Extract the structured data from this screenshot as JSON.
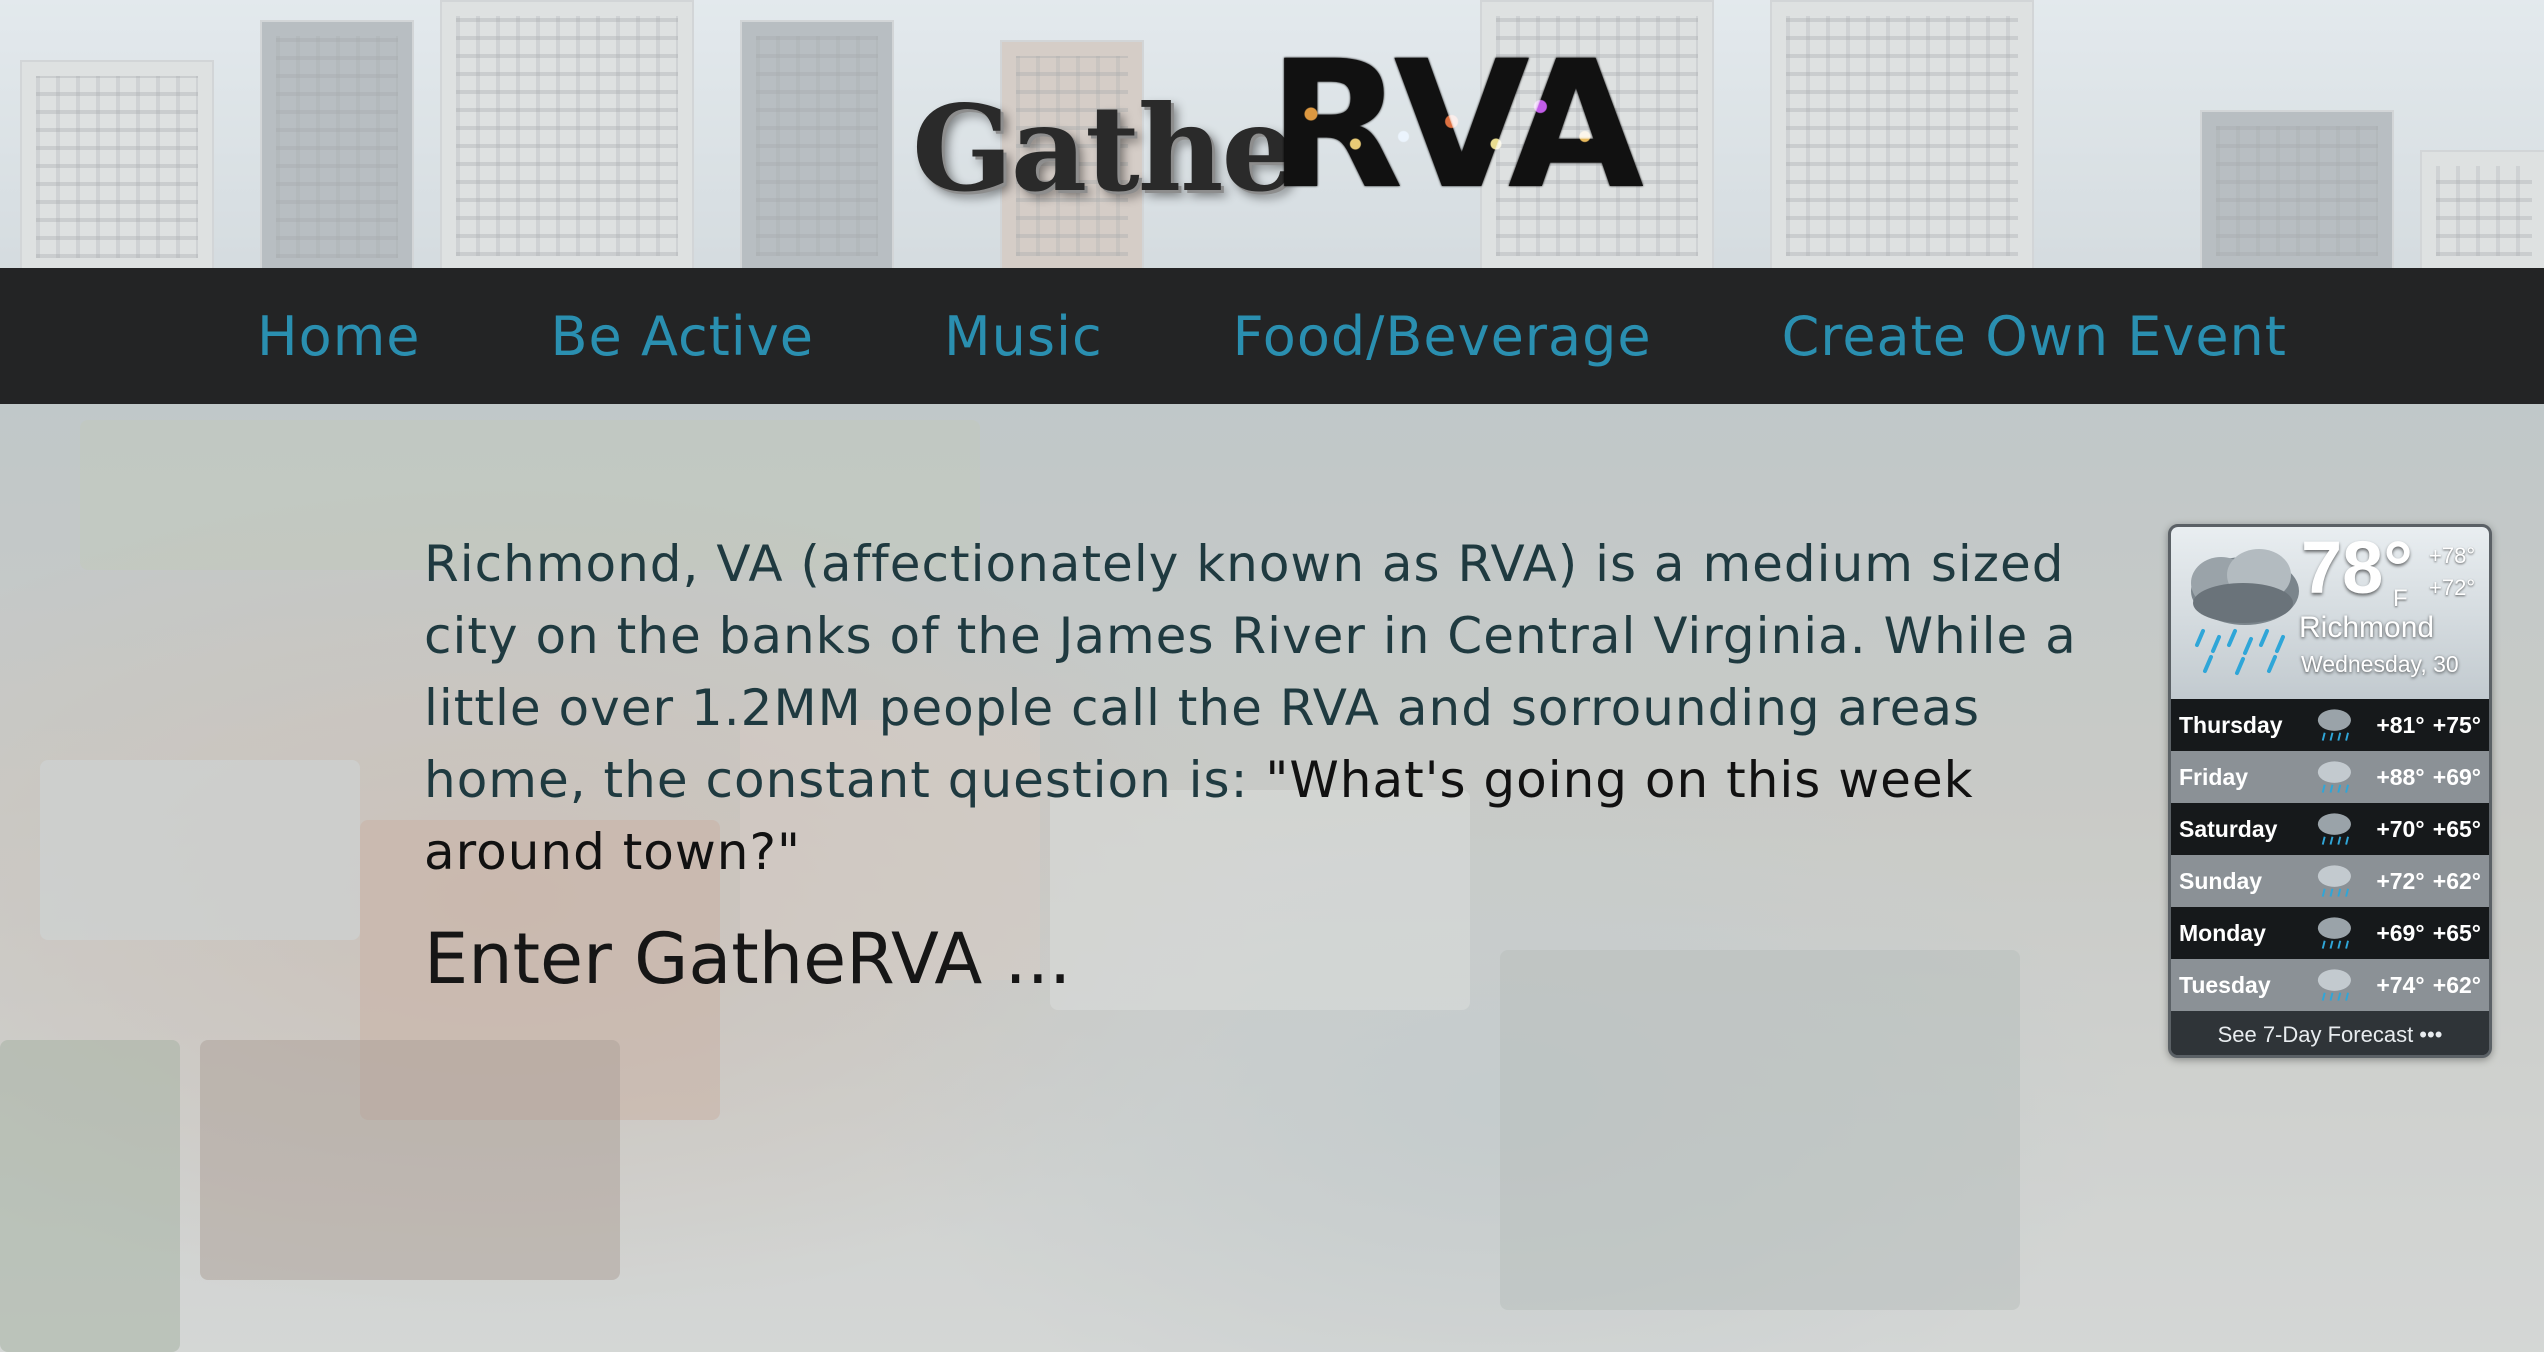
{
  "logo": {
    "script_text": "Gathe",
    "block_text": "RVA"
  },
  "nav": {
    "items": [
      {
        "label": "Home"
      },
      {
        "label": "Be Active"
      },
      {
        "label": "Music"
      },
      {
        "label": "Food/Beverage"
      },
      {
        "label": "Create Own Event"
      }
    ]
  },
  "intro": {
    "paragraph": "Richmond, VA (affectionately known as RVA) is a medium sized city on the banks of the James River in Central Virginia. While a little over 1.2MM people call the RVA and sorrounding areas home, the constant question is: ",
    "quote": "\"What's going on this week around town?\"",
    "enter": "Enter GatheRVA ..."
  },
  "weather": {
    "current_temp": "78°",
    "unit": "F",
    "hi": "+78°",
    "lo": "+72°",
    "city": "Richmond",
    "date": "Wednesday, 30",
    "forecast": [
      {
        "day": "Thursday",
        "hi": "+81°",
        "lo": "+75°",
        "icon": "rain-cloud-icon"
      },
      {
        "day": "Friday",
        "hi": "+88°",
        "lo": "+69°",
        "icon": "rain-cloud-icon"
      },
      {
        "day": "Saturday",
        "hi": "+70°",
        "lo": "+65°",
        "icon": "rain-cloud-icon"
      },
      {
        "day": "Sunday",
        "hi": "+72°",
        "lo": "+62°",
        "icon": "rain-cloud-icon"
      },
      {
        "day": "Monday",
        "hi": "+69°",
        "lo": "+65°",
        "icon": "rain-cloud-icon"
      },
      {
        "day": "Tuesday",
        "hi": "+74°",
        "lo": "+62°",
        "icon": "rain-cloud-icon"
      }
    ],
    "footer": "See 7-Day Forecast •••"
  },
  "colors": {
    "nav_bg": "#232425",
    "nav_link": "#2a8fb0",
    "widget_bg": "#2f3438"
  }
}
